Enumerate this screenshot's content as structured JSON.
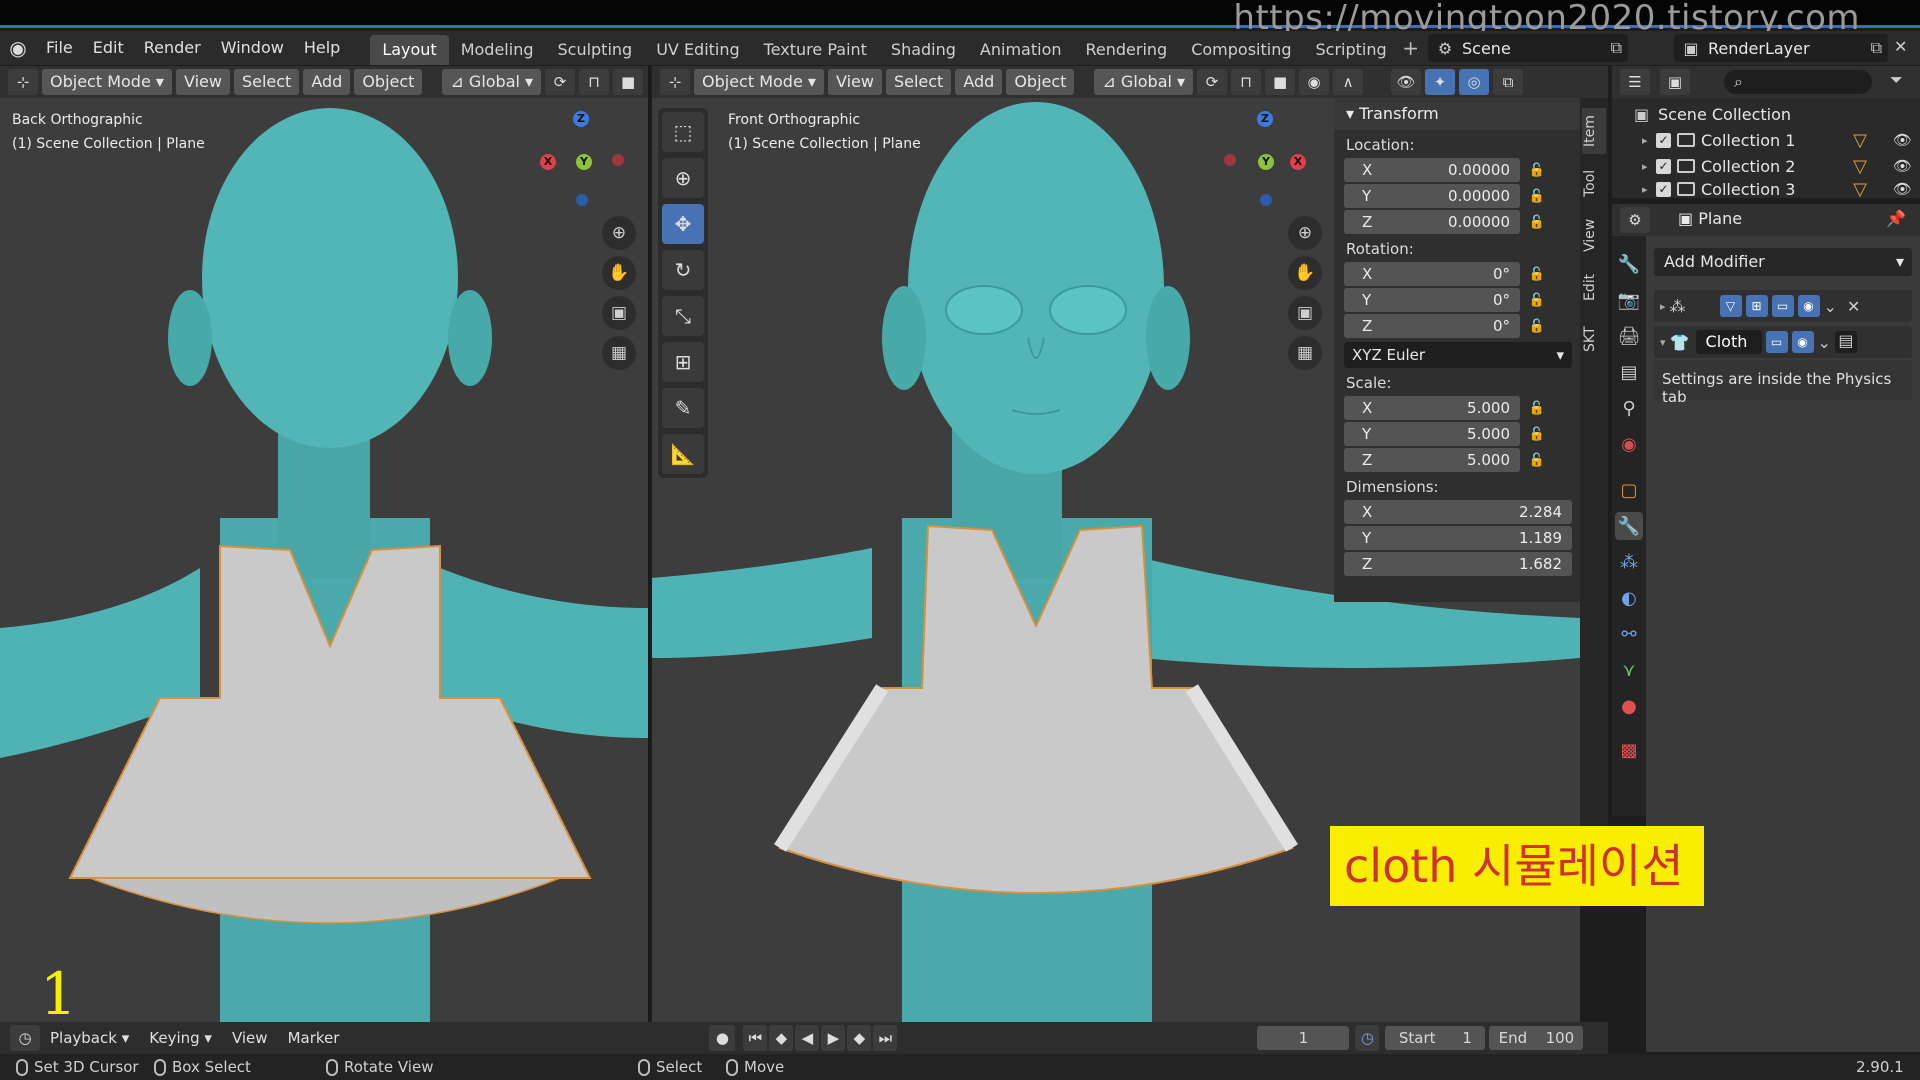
{
  "url_overlay": "https://movingtoon2020.tistory.com",
  "menu": [
    "File",
    "Edit",
    "Render",
    "Window",
    "Help"
  ],
  "workspaces": [
    "Layout",
    "Modeling",
    "Sculpting",
    "UV Editing",
    "Texture Paint",
    "Shading",
    "Animation",
    "Rendering",
    "Compositing",
    "Scripting"
  ],
  "active_workspace": "Layout",
  "scene": "Scene",
  "render_layer": "RenderLayer",
  "left_viewport": {
    "mode": "Object Mode",
    "menus": [
      "View",
      "Select",
      "Add",
      "Object"
    ],
    "orientation": "Global",
    "view_label": "Back Orthographic",
    "collection_label": "(1) Scene Collection | Plane"
  },
  "right_viewport": {
    "mode": "Object Mode",
    "menus": [
      "View",
      "Select",
      "Add",
      "Object"
    ],
    "orientation": "Global",
    "view_label": "Front Orthographic",
    "collection_label": "(1) Scene Collection | Plane"
  },
  "gizmo_left": {
    "z": "Z",
    "x": "X",
    "y": "Y"
  },
  "gizmo_right": {
    "z": "Z",
    "x": "X",
    "y": "Y"
  },
  "transform": {
    "title": "Transform",
    "location_label": "Location:",
    "location": {
      "x": "0.00000",
      "y": "0.00000",
      "z": "0.00000"
    },
    "rotation_label": "Rotation:",
    "rotation": {
      "x": "0°",
      "y": "0°",
      "z": "0°"
    },
    "rotation_mode": "XYZ Euler",
    "scale_label": "Scale:",
    "scale": {
      "x": "5.000",
      "y": "5.000",
      "z": "5.000"
    },
    "dimensions_label": "Dimensions:",
    "dimensions": {
      "x": "2.284",
      "y": "1.189",
      "z": "1.682"
    },
    "axis": {
      "x": "X",
      "y": "Y",
      "z": "Z"
    }
  },
  "side_tabs": [
    "Item",
    "Tool",
    "View",
    "Edit",
    "SKT"
  ],
  "outliner": {
    "root": "Scene Collection",
    "collections": [
      "Collection 1",
      "Collection 2",
      "Collection 3"
    ]
  },
  "properties": {
    "object_name": "Plane",
    "add_modifier": "Add Modifier",
    "cloth_label": "Cloth",
    "cloth_note": "Settings are inside the Physics tab"
  },
  "timeline": {
    "menus": [
      "Playback",
      "Keying",
      "View",
      "Marker"
    ],
    "current_frame": "1",
    "start_label": "Start",
    "start": "1",
    "end_label": "End",
    "end": "100"
  },
  "statusbar": {
    "items": [
      "Set 3D Cursor",
      "Box Select",
      "Rotate View",
      "Select",
      "Move"
    ],
    "version": "2.90.1"
  },
  "overlay_frame_number": "1",
  "annotation": "cloth 시뮬레이션",
  "colors": {
    "body": "#4fb3b3",
    "cloth": "#c8c8c8",
    "accent": "#4772b3",
    "annotation_bg": "#f9ee00",
    "annotation_text": "#d03030"
  }
}
